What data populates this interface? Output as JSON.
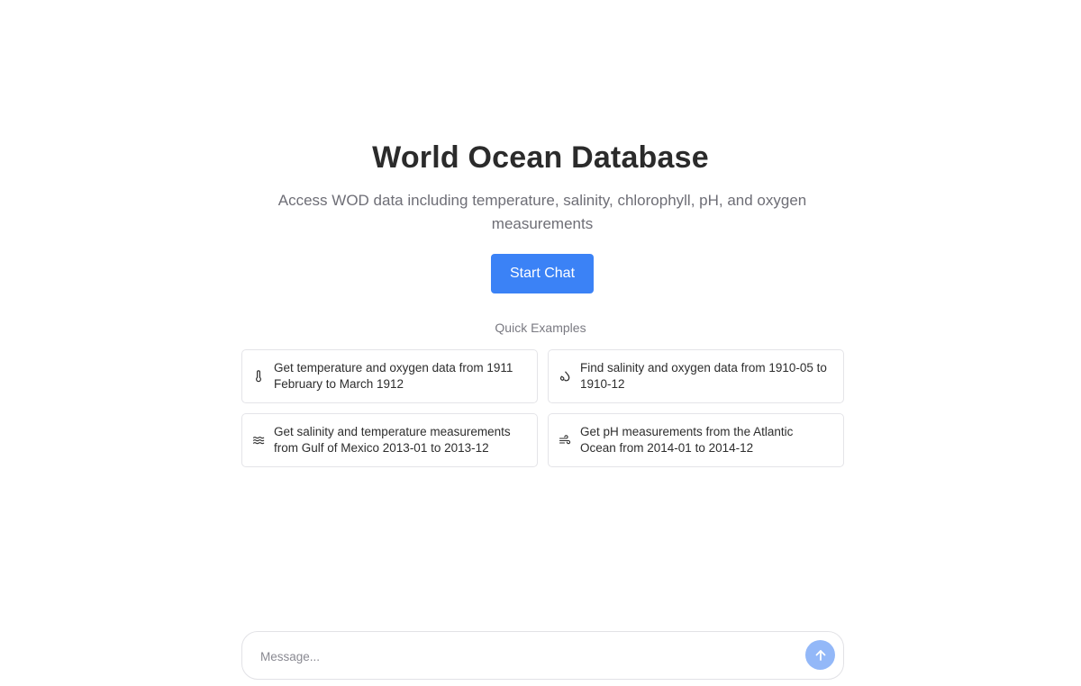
{
  "hero": {
    "title": "World Ocean Database",
    "subtitle": "Access WOD data including temperature, salinity, chlorophyll, pH, and oxygen measurements",
    "start_button": "Start Chat"
  },
  "quick_examples": {
    "label": "Quick Examples",
    "items": [
      {
        "icon": "thermometer-icon",
        "text": "Get temperature and oxygen data from 1911 February to March 1912"
      },
      {
        "icon": "droplets-icon",
        "text": "Find salinity and oxygen data from 1910-05 to 1910-12"
      },
      {
        "icon": "waves-icon",
        "text": "Get salinity and temperature measurements from Gulf of Mexico 2013-01 to 2013-12"
      },
      {
        "icon": "wind-icon",
        "text": "Get pH measurements from the Atlantic Ocean from 2014-01 to 2014-12"
      }
    ]
  },
  "composer": {
    "placeholder": "Message...",
    "send_icon": "arrow-up-icon"
  },
  "colors": {
    "accent": "#3b82f6",
    "send_button_disabled": "#93b8f8",
    "title_text": "#2b2b2b",
    "muted_text": "#6e6e76"
  }
}
